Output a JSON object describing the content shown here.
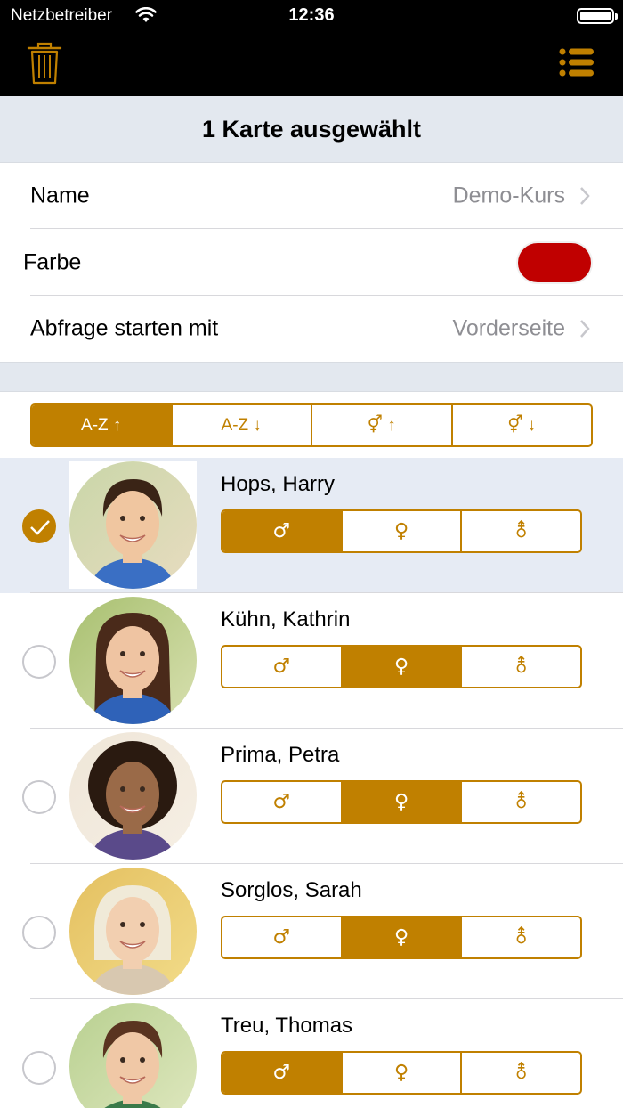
{
  "status_bar": {
    "carrier": "Netzbetreiber",
    "time": "12:36"
  },
  "nav": {
    "left_icon": "trash-icon",
    "right_icon": "list-icon"
  },
  "header": {
    "title": "1 Karte ausgewählt"
  },
  "settings": {
    "name_label": "Name",
    "name_value": "Demo-Kurs",
    "color_label": "Farbe",
    "color_value": "#c00000",
    "query_label": "Abfrage starten mit",
    "query_value": "Vorderseite"
  },
  "sort": {
    "options": [
      "A-Z ↑",
      "A-Z ↓",
      "⚥ ↑",
      "⚥ ↓"
    ],
    "selected": 0
  },
  "gender_symbols": [
    "♂",
    "♀",
    "⚨"
  ],
  "people": [
    {
      "name": "Hops, Harry",
      "gender": 0,
      "selected": true
    },
    {
      "name": "Kühn, Kathrin",
      "gender": 1,
      "selected": false
    },
    {
      "name": "Prima, Petra",
      "gender": 1,
      "selected": false
    },
    {
      "name": "Sorglos, Sarah",
      "gender": 1,
      "selected": false
    },
    {
      "name": "Treu, Thomas",
      "gender": 0,
      "selected": false
    }
  ],
  "colors": {
    "accent": "#c08000",
    "header_bg": "#e3e8ef",
    "selected_row_bg": "#e6ebf4"
  }
}
